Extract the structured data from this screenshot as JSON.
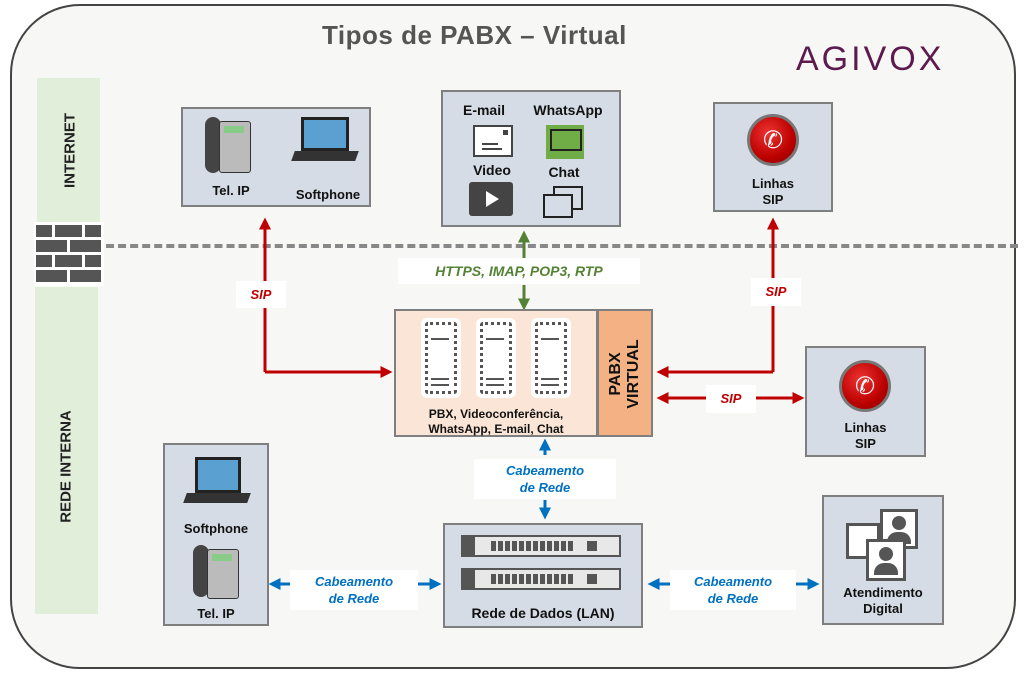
{
  "title": "Tipos de PABX – Virtual",
  "logo": "AGIVOX",
  "zones": {
    "internet": "INTERNET",
    "internal": "REDE INTERNA"
  },
  "nodes": {
    "ip_devices_top": {
      "phone_label": "Tel. IP",
      "softphone_label": "Softphone"
    },
    "channels": {
      "email": "E-mail",
      "whatsapp": "WhatsApp",
      "video": "Video",
      "chat": "Chat"
    },
    "sip_lines_top": {
      "line1": "Linhas",
      "line2": "SIP"
    },
    "pabx": {
      "services_line1": "PBX, Videoconferência,",
      "services_line2": "WhatsApp, E-mail, Chat",
      "vertical_line1": "PABX",
      "vertical_line2": "VIRTUAL"
    },
    "sip_lines_right": {
      "line1": "Linhas",
      "line2": "SIP"
    },
    "ip_devices_bottom": {
      "softphone_label": "Softphone",
      "phone_label": "Tel. IP"
    },
    "lan": {
      "label": "Rede de Dados (LAN)"
    },
    "digital": {
      "line1": "Atendimento",
      "line2": "Digital"
    }
  },
  "connections": {
    "sip_left": "SIP",
    "sip_top_right": "SIP",
    "sip_right": "SIP",
    "protocols": "HTTPS, IMAP, POP3, RTP",
    "cabling_top_line1": "Cabeamento",
    "cabling_top_line2": "de Rede",
    "cabling_left_line1": "Cabeamento",
    "cabling_left_line2": "de Rede",
    "cabling_right_line1": "Cabeamento",
    "cabling_right_line2": "de Rede"
  },
  "colors": {
    "sip": "#c00000",
    "protocols": "#548235",
    "cabling": "#0070c0",
    "pabx_fill": "#fbe5d6",
    "pabx_accent": "#f4b183",
    "logo": "#5c1a4e",
    "zone_band": "#e1eed9"
  }
}
